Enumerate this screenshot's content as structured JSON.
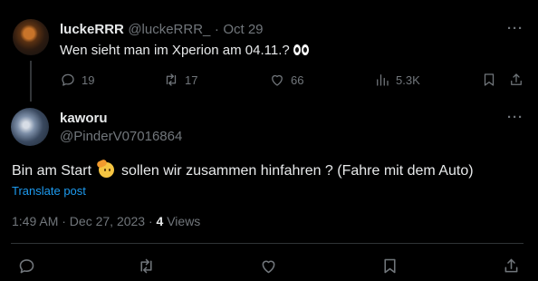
{
  "quoted_tweet": {
    "display_name": "luckeRRR",
    "handle": "@luckeRRR_",
    "separator": "·",
    "date": "Oct 29",
    "text": "Wen sieht man im Xperion am 04.11.?",
    "emoji": "eyes",
    "more": "···",
    "stats": {
      "replies": "19",
      "reposts": "17",
      "likes": "66",
      "views": "5.3K"
    }
  },
  "main_tweet": {
    "display_name": "kaworu",
    "handle": "@PinderV07016864",
    "more": "···",
    "text_before_emoji": "Bin am Start",
    "emoji": "saluting-face",
    "text_after_emoji": "sollen wir zusammen hinfahren ? (Fahre mit dem Auto)",
    "translate_label": "Translate post",
    "timestamp": "1:49 AM · Dec 27, 2023 ·",
    "views_count": "4",
    "views_label": "Views"
  },
  "icons": {
    "reply": "reply-icon",
    "repost": "repost-icon",
    "like": "like-icon",
    "views": "views-icon",
    "bookmark": "bookmark-icon",
    "share": "share-icon"
  },
  "colors": {
    "background": "#000000",
    "text": "#e7e9ea",
    "muted": "#71767b",
    "link": "#1d9bf0",
    "divider": "#2f3336"
  }
}
